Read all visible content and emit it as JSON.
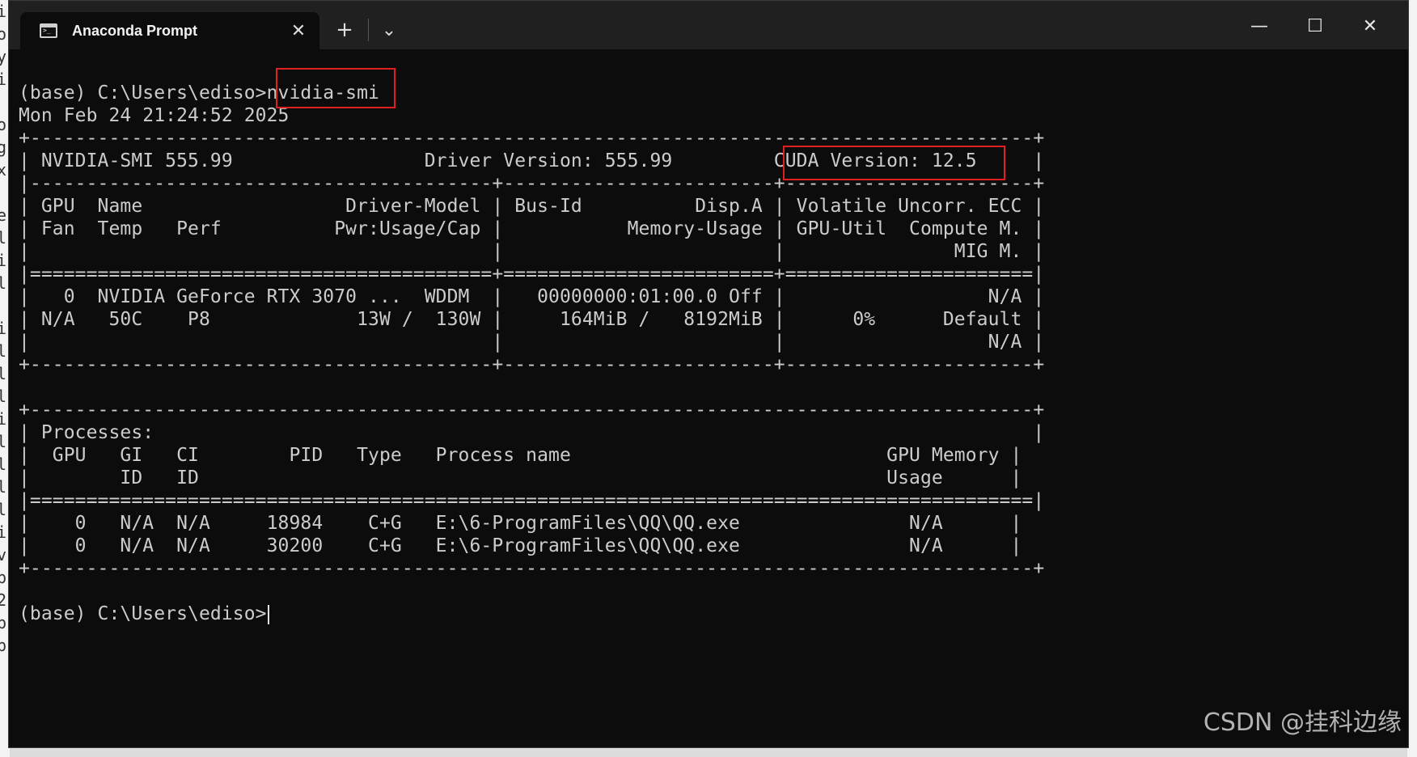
{
  "window": {
    "tab_title": "Anaconda Prompt",
    "new_tab_label": "+",
    "dropdown_label": "⌄",
    "tab_close_label": "✕",
    "minimize_label": "—",
    "maximize_label": "☐",
    "close_label": "✕"
  },
  "terminal": {
    "prompt": "(base) C:\\Users\\ediso>",
    "command": "nvidia-smi",
    "lines": [
      "Mon Feb 24 21:24:52 2025",
      "+-----------------------------------------------------------------------------------------+",
      "| NVIDIA-SMI 555.99                 Driver Version: 555.99         CUDA Version: 12.5     |",
      "|-----------------------------------------+------------------------+----------------------+",
      "| GPU  Name                  Driver-Model | Bus-Id          Disp.A | Volatile Uncorr. ECC |",
      "| Fan  Temp   Perf          Pwr:Usage/Cap |           Memory-Usage | GPU-Util  Compute M. |",
      "|                                         |                        |               MIG M. |",
      "|=========================================+========================+======================|",
      "|   0  NVIDIA GeForce RTX 3070 ...  WDDM  |   00000000:01:00.0 Off |                  N/A |",
      "| N/A   50C    P8             13W /  130W |     164MiB /   8192MiB |      0%      Default |",
      "|                                         |                        |                  N/A |",
      "+-----------------------------------------+------------------------+----------------------+",
      "",
      "+-----------------------------------------------------------------------------------------+",
      "| Processes:                                                                              |",
      "|  GPU   GI   CI        PID   Type   Process name                            GPU Memory |",
      "|        ID   ID                                                             Usage      |",
      "|=========================================================================================|",
      "|    0   N/A  N/A     18984    C+G   E:\\6-ProgramFiles\\QQ\\QQ.exe               N/A      |",
      "|    0   N/A  N/A     30200    C+G   E:\\6-ProgramFiles\\QQ\\QQ.exe               N/A      |",
      "+-----------------------------------------------------------------------------------------+",
      ""
    ],
    "final_prompt": "(base) C:\\Users\\ediso>"
  },
  "watermark": "CSDN @挂科边缘",
  "colors": {
    "terminal_bg": "#0c0c0c",
    "text": "#cccccc",
    "highlight": "#e02020",
    "titlebar": "#202020"
  }
}
